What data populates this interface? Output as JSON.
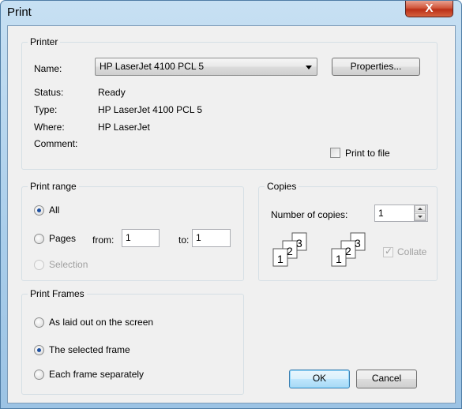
{
  "window": {
    "title": "Print",
    "close_glyph": "X"
  },
  "printer": {
    "group_label": "Printer",
    "name_label": "Name:",
    "name_value": "HP LaserJet 4100 PCL 5",
    "properties_button": "Properties...",
    "status_label": "Status:",
    "status_value": "Ready",
    "type_label": "Type:",
    "type_value": "HP LaserJet 4100 PCL 5",
    "where_label": "Where:",
    "where_value": "HP LaserJet",
    "comment_label": "Comment:",
    "print_to_file": {
      "label": "Print to file",
      "checked": false
    }
  },
  "print_range": {
    "group_label": "Print range",
    "all_label": "All",
    "pages_label": "Pages",
    "from_label": "from:",
    "from_value": "1",
    "to_label": "to:",
    "to_value": "1",
    "selection_label": "Selection",
    "selected": "All"
  },
  "copies": {
    "group_label": "Copies",
    "number_label": "Number of copies:",
    "number_value": "1",
    "collate_label": "Collate",
    "collate_checked": true,
    "collate_enabled": false,
    "page_glyphs": [
      "1",
      "2",
      "3"
    ]
  },
  "print_frames": {
    "group_label": "Print Frames",
    "options": [
      "As laid out on the screen",
      "The selected frame",
      "Each frame separately"
    ],
    "selected": "The selected frame"
  },
  "buttons": {
    "ok": "OK",
    "cancel": "Cancel"
  },
  "colors": {
    "accent": "#3c7fb1",
    "titlebar": "#a9cdea",
    "close": "#c0392b"
  }
}
